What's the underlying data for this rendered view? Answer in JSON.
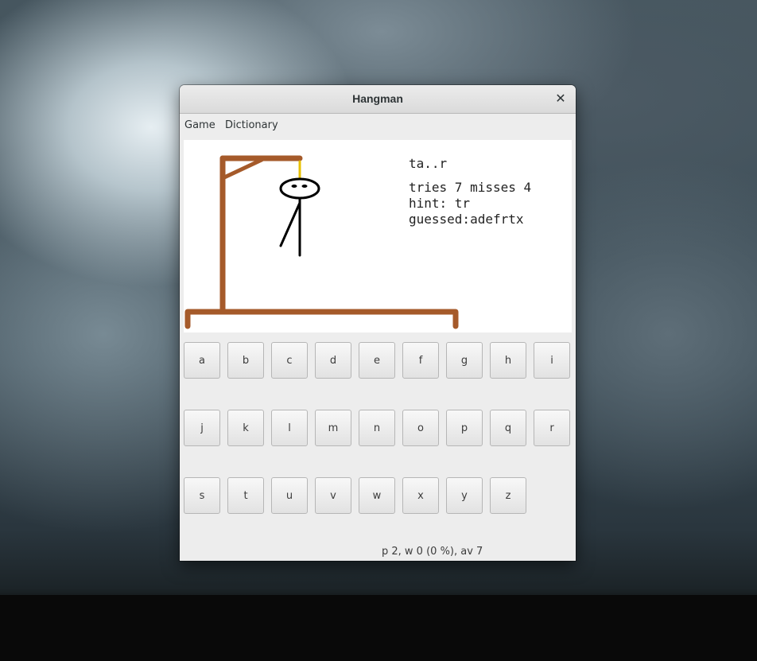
{
  "window": {
    "title": "Hangman"
  },
  "menu": {
    "items": [
      "Game",
      "Dictionary"
    ]
  },
  "game": {
    "word": "ta..r",
    "tries_line": "tries 7 misses 4",
    "hint_line": "hint: tr",
    "guessed_line": "guessed:adefrtx",
    "misses": 4
  },
  "keyboard": {
    "rows": [
      [
        "a",
        "b",
        "c",
        "d",
        "e",
        "f",
        "g",
        "h",
        "i"
      ],
      [
        "j",
        "k",
        "l",
        "m",
        "n",
        "o",
        "p",
        "q",
        "r"
      ],
      [
        "s",
        "t",
        "u",
        "v",
        "w",
        "x",
        "y",
        "z"
      ]
    ]
  },
  "status": {
    "text": "p 2, w 0 (0 %), av 7"
  },
  "colors": {
    "gallows": "#a55a2a",
    "rope": "#e8c000",
    "figure": "#000000"
  },
  "icons": {
    "close": "close-icon"
  }
}
